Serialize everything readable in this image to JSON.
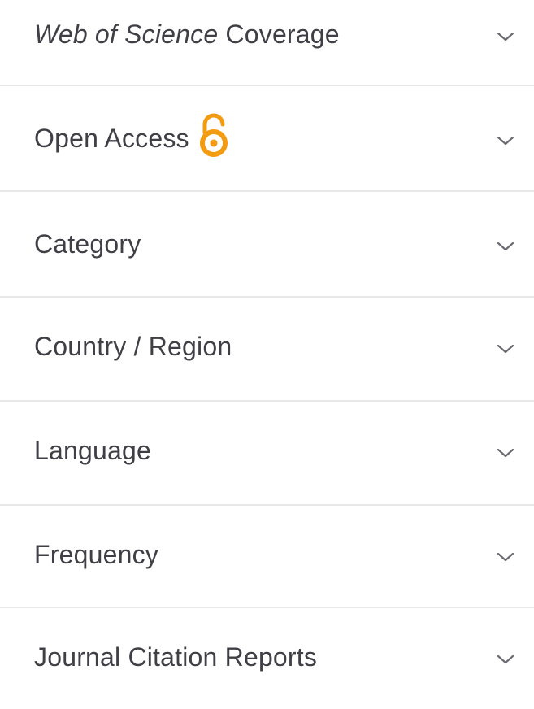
{
  "filters": [
    {
      "label": "Web of Science Coverage",
      "italic_part": "Web of Science",
      "rest": " Coverage",
      "icon": "chevron-down-icon"
    },
    {
      "label": "Open Access",
      "icon": "chevron-down-icon",
      "badge_icon": "open-access-lock-icon",
      "badge_color": "#f39c12"
    },
    {
      "label": "Category",
      "icon": "chevron-down-icon"
    },
    {
      "label": "Country / Region",
      "icon": "chevron-down-icon"
    },
    {
      "label": "Language",
      "icon": "chevron-down-icon"
    },
    {
      "label": "Frequency",
      "icon": "chevron-down-icon"
    },
    {
      "label": "Journal Citation Reports",
      "icon": "chevron-down-icon"
    }
  ],
  "colors": {
    "text": "#3f3f46",
    "divider": "#e7e7ea",
    "chevron": "#6b6b73",
    "open_access": "#f39c12"
  }
}
